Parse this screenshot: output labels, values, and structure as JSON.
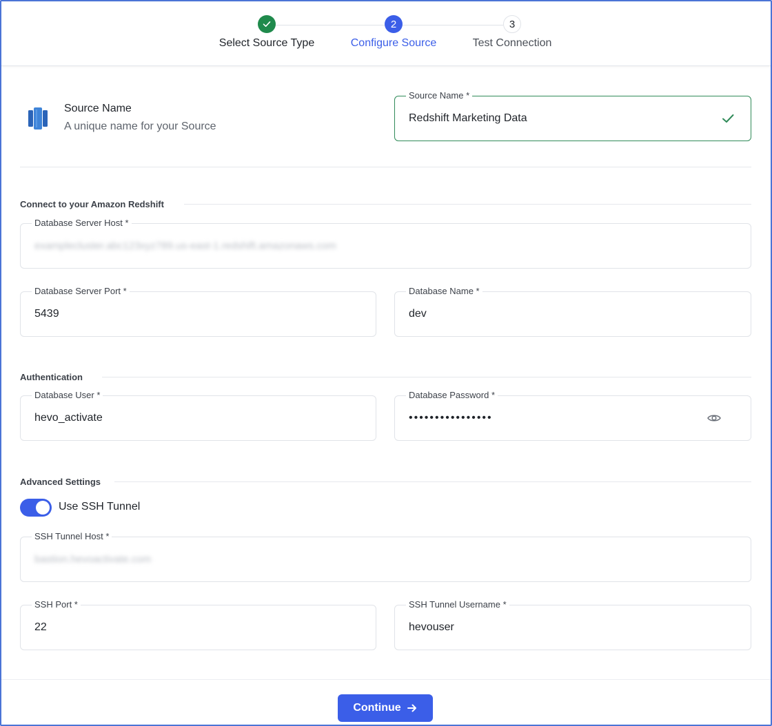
{
  "stepper": {
    "steps": [
      {
        "number": "1",
        "label": "Select Source Type",
        "state": "complete"
      },
      {
        "number": "2",
        "label": "Configure Source",
        "state": "active"
      },
      {
        "number": "3",
        "label": "Test Connection",
        "state": "pending"
      }
    ]
  },
  "source": {
    "title": "Source Name",
    "subtitle": "A unique name for your Source",
    "icon": "amazon-redshift-icon",
    "field_label": "Source Name *",
    "field_value": "Redshift Marketing Data"
  },
  "connection": {
    "section_title": "Connect to your Amazon Redshift",
    "host_label": "Database Server Host *",
    "host_value": "examplecluster.abc123xyz789.us-east-1.redshift.amazonaws.com",
    "port_label": "Database Server Port *",
    "port_value": "5439",
    "dbname_label": "Database Name *",
    "dbname_value": "dev"
  },
  "auth": {
    "section_title": "Authentication",
    "user_label": "Database User *",
    "user_value": "hevo_activate",
    "password_label": "Database Password *",
    "password_value": "••••••••••••••••"
  },
  "advanced": {
    "section_title": "Advanced Settings",
    "ssh_toggle_label": "Use SSH Tunnel",
    "ssh_enabled": true,
    "ssh_host_label": "SSH Tunnel Host *",
    "ssh_host_value": "bastion.hevoactivate.com",
    "ssh_port_label": "SSH Port *",
    "ssh_port_value": "22",
    "ssh_user_label": "SSH Tunnel Username *",
    "ssh_user_value": "hevouser"
  },
  "footer": {
    "continue_label": "Continue"
  },
  "colors": {
    "primary": "#3b5ee8",
    "success": "#1f8a4c",
    "border": "#e0e3e8"
  }
}
